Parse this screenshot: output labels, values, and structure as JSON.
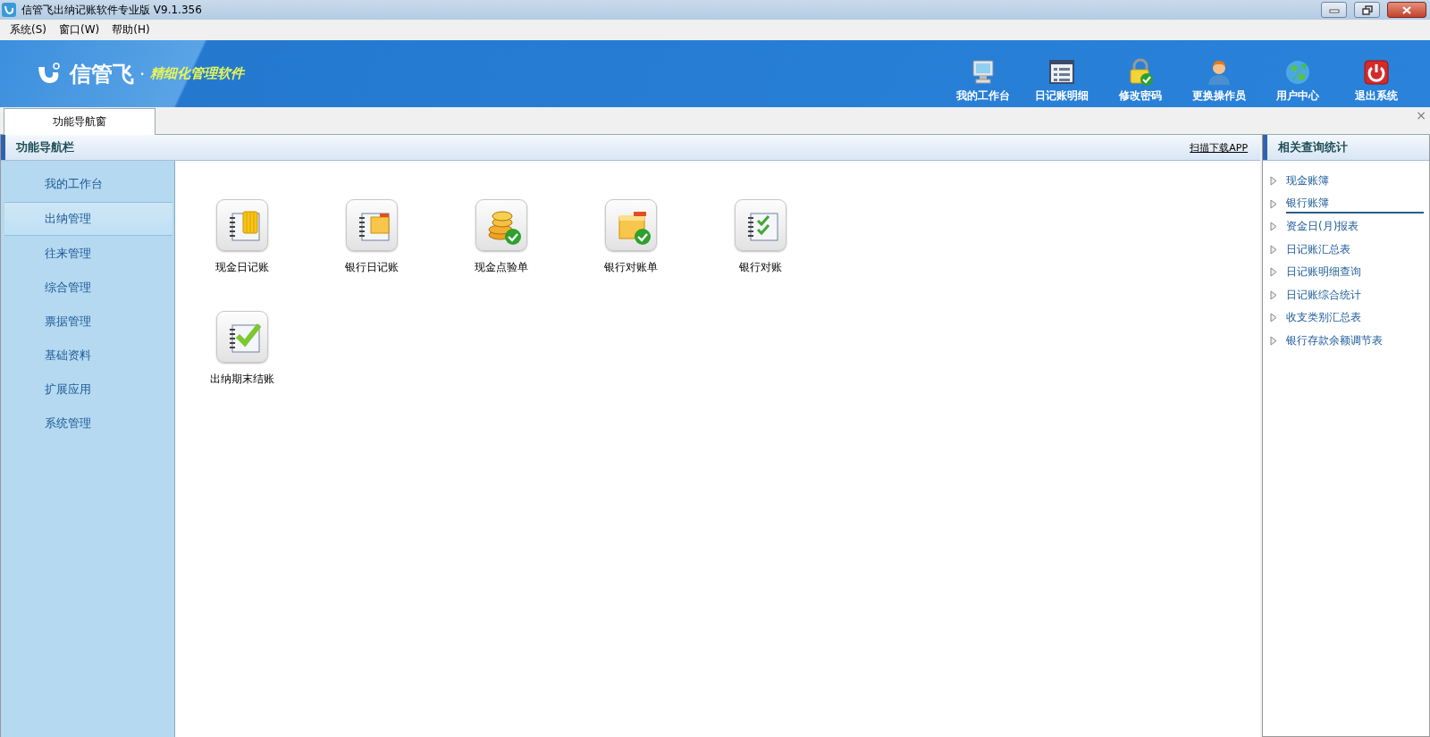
{
  "window": {
    "title": "信管飞出纳记账软件专业版 V9.1.356"
  },
  "menu": [
    "系统(S)",
    "窗口(W)",
    "帮助(H)"
  ],
  "banner": {
    "brand": "信管飞",
    "dot": "·",
    "slogan": "精细化管理软件"
  },
  "toolbar": [
    {
      "label": "我的工作台"
    },
    {
      "label": "日记账明细"
    },
    {
      "label": "修改密码"
    },
    {
      "label": "更换操作员"
    },
    {
      "label": "用户中心"
    },
    {
      "label": "退出系统"
    }
  ],
  "tabs": [
    {
      "label": "功能导航窗",
      "selected": true
    }
  ],
  "tab_close": "×",
  "nav": {
    "title": "功能导航栏",
    "download_link": "扫描下载APP",
    "items": [
      {
        "label": "我的工作台",
        "selected": false
      },
      {
        "label": "出纳管理",
        "selected": true
      },
      {
        "label": "往来管理",
        "selected": false
      },
      {
        "label": "综合管理",
        "selected": false
      },
      {
        "label": "票据管理",
        "selected": false
      },
      {
        "label": "基础资料",
        "selected": false
      },
      {
        "label": "扩展应用",
        "selected": false
      },
      {
        "label": "系统管理",
        "selected": false
      }
    ]
  },
  "functions": [
    {
      "label": "现金日记账"
    },
    {
      "label": "银行日记账"
    },
    {
      "label": "现金点验单"
    },
    {
      "label": "银行对账单"
    },
    {
      "label": "银行对账"
    },
    {
      "label": "出纳期末结账"
    }
  ],
  "query": {
    "title": "相关查询统计",
    "items": [
      {
        "label": "现金账簿",
        "selected": false
      },
      {
        "label": "银行账簿",
        "selected": true
      },
      {
        "label": "资金日(月)报表",
        "selected": false
      },
      {
        "label": "日记账汇总表",
        "selected": false
      },
      {
        "label": "日记账明细查询",
        "selected": false
      },
      {
        "label": "日记账综合统计",
        "selected": false
      },
      {
        "label": "收支类别汇总表",
        "selected": false
      },
      {
        "label": "银行存款余额调节表",
        "selected": false
      }
    ]
  }
}
